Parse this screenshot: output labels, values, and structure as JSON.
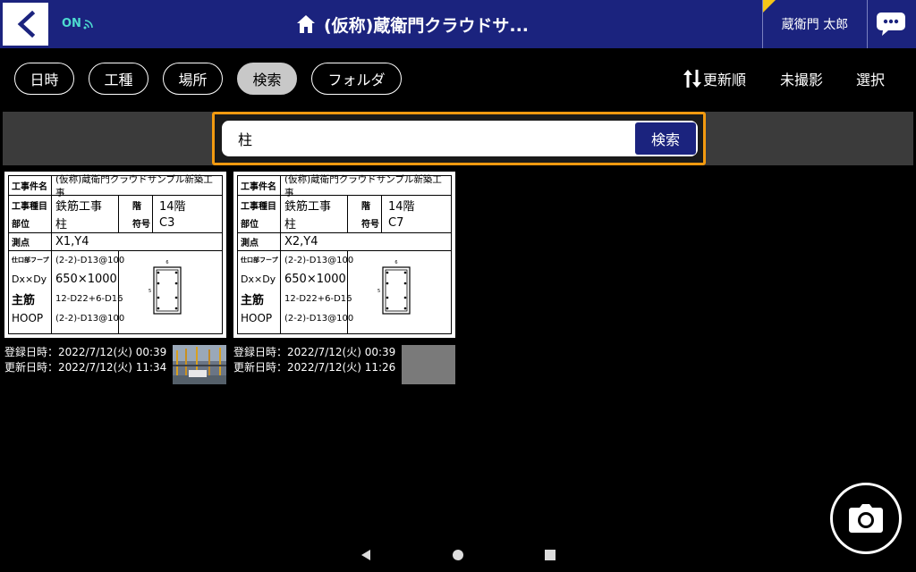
{
  "header": {
    "on_label": "ON",
    "title": "(仮称)蔵衛門クラウドサ...",
    "user_name": "蔵衛門 太郎"
  },
  "filters": {
    "items": [
      {
        "label": "日時",
        "active": false
      },
      {
        "label": "工種",
        "active": false
      },
      {
        "label": "場所",
        "active": false
      },
      {
        "label": "検索",
        "active": true
      },
      {
        "label": "フォルダ",
        "active": false
      }
    ],
    "sort_label": "更新順",
    "unshot_label": "未撮影",
    "select_label": "選択"
  },
  "search": {
    "value": "柱",
    "button_label": "検索"
  },
  "board_labels": {
    "project": "工事件名",
    "work_type": "工事種目",
    "floor": "階",
    "part": "部位",
    "code": "符号",
    "point": "測点",
    "hoop_top": "仕口部フープ",
    "dim": "Dx×Dy",
    "main_bar": "主筋",
    "hoop": "HOOP"
  },
  "cards": [
    {
      "project": "(仮称)蔵衛門クラウドサンプル新築工事",
      "work_type": "鉄筋工事",
      "floor": "14階",
      "part": "柱",
      "code": "C3",
      "point": "X1,Y4",
      "hoop_top": "(2-2)-D13@100",
      "dim": "650×1000",
      "main_bar": "12-D22+6-D16",
      "hoop": "(2-2)-D13@100",
      "registered": "登録日時：2022/7/12(火)  00:39",
      "updated": "更新日時：2022/7/12(火)  11:34",
      "thumb": "photo"
    },
    {
      "project": "(仮称)蔵衛門クラウドサンプル新築工事",
      "work_type": "鉄筋工事",
      "floor": "14階",
      "part": "柱",
      "code": "C7",
      "point": "X2,Y4",
      "hoop_top": "(2-2)-D13@100",
      "dim": "650×1000",
      "main_bar": "12-D22+6-D16",
      "hoop": "(2-2)-D13@100",
      "registered": "登録日時：2022/7/12(火)  00:39",
      "updated": "更新日時：2022/7/12(火)  11:26",
      "thumb": "placeholder"
    }
  ],
  "colors": {
    "header_bg": "#1b237e",
    "accent_orange": "#f29a10",
    "online_teal": "#4ddcd0"
  }
}
